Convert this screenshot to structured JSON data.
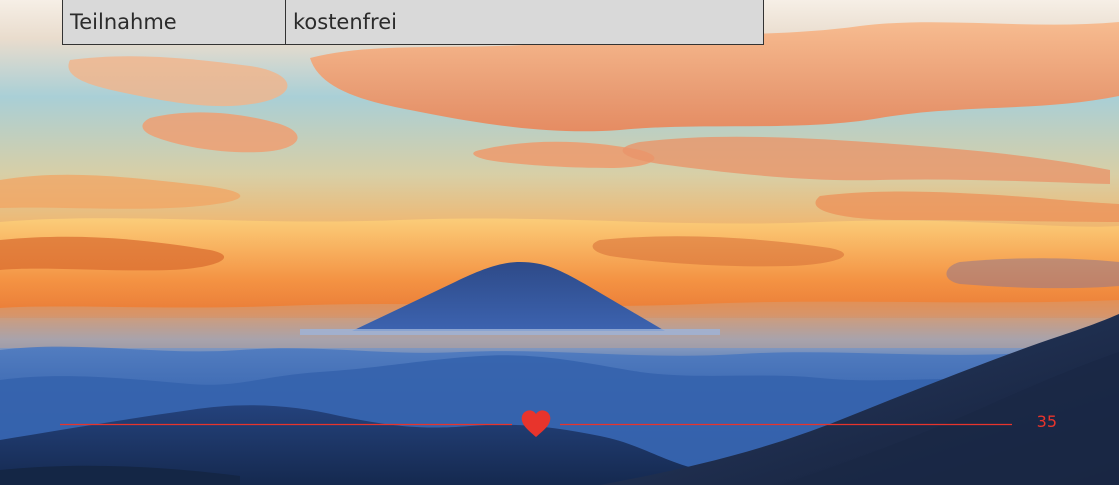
{
  "table": {
    "rows": [
      {
        "label": "Teilnahme",
        "value": "kostenfrei"
      }
    ]
  },
  "footer": {
    "page_number": "35",
    "accent_color": "#e8342c",
    "ornament_icon": "heart-icon"
  }
}
